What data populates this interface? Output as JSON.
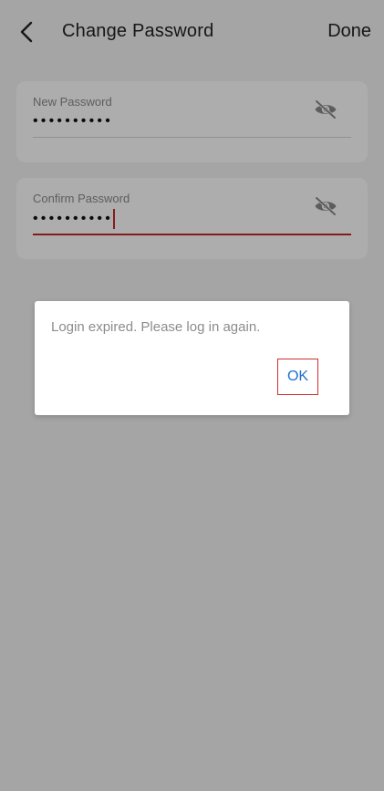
{
  "header": {
    "title": "Change Password",
    "done_label": "Done",
    "back_icon": "chevron-left-icon"
  },
  "fields": [
    {
      "label": "New Password",
      "masked_value": "••••••••••",
      "toggle_icon": "eye-off-icon",
      "focused": false
    },
    {
      "label": "Confirm Password",
      "masked_value": "••••••••••",
      "toggle_icon": "eye-off-icon",
      "focused": true
    }
  ],
  "dialog": {
    "message": "Login expired. Please log in again.",
    "ok_label": "OK"
  },
  "colors": {
    "accent_red": "#c62828",
    "link_blue": "#1e6fd0",
    "overlay": "rgba(0,0,0,0.32)"
  }
}
